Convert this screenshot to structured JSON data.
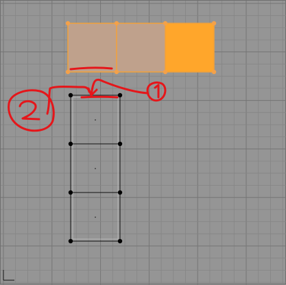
{
  "viewport": {
    "background_color": "#959595",
    "minor_grid_color": "#858585",
    "major_grid_color": "#757575"
  },
  "mesh": {
    "selected_fill": "#ffa62b",
    "selected_edge": "#f2a13a",
    "faded_fill": "#bfa18c",
    "vertex_selected": "#f3a14a",
    "unselected_edge": "#111111",
    "vertex_unselected": "#000000"
  },
  "annotation": {
    "color": "#e5161a",
    "labels": [
      "1",
      "2"
    ]
  },
  "icons": {
    "axis": "axis-gizmo-icon"
  }
}
